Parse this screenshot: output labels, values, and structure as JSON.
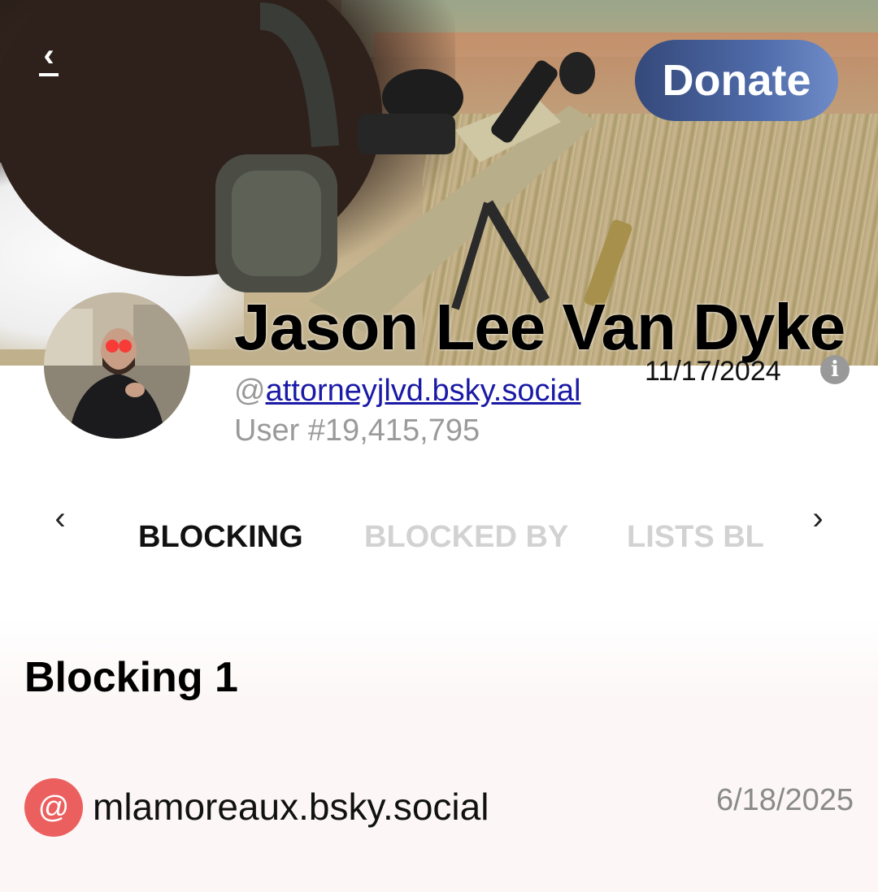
{
  "header": {
    "back_label": "‹",
    "donate_label": "Donate"
  },
  "profile": {
    "display_name": "Jason Lee Van Dyke",
    "handle_prefix": "@",
    "handle": "attorneyjlvd.bsky.social",
    "user_number": "User #19,415,795",
    "joined_date": "11/17/2024",
    "info_icon": "i"
  },
  "tabs": {
    "prev_label": "‹",
    "next_label": "›",
    "items": [
      {
        "label": "BLOCKING",
        "active": true
      },
      {
        "label": "BLOCKED BY",
        "active": false
      },
      {
        "label": "LISTS BL",
        "active": false
      }
    ]
  },
  "section": {
    "title": "Blocking 1",
    "rows": [
      {
        "icon": "@",
        "handle": "mlamoreaux.bsky.social",
        "date": "6/18/2025"
      }
    ]
  },
  "colors": {
    "accent_link": "#1a1aa6",
    "donate_bg": "#4e6aa8",
    "at_icon_bg": "#ec5f5f",
    "inactive_tab": "#d2d2d2"
  }
}
